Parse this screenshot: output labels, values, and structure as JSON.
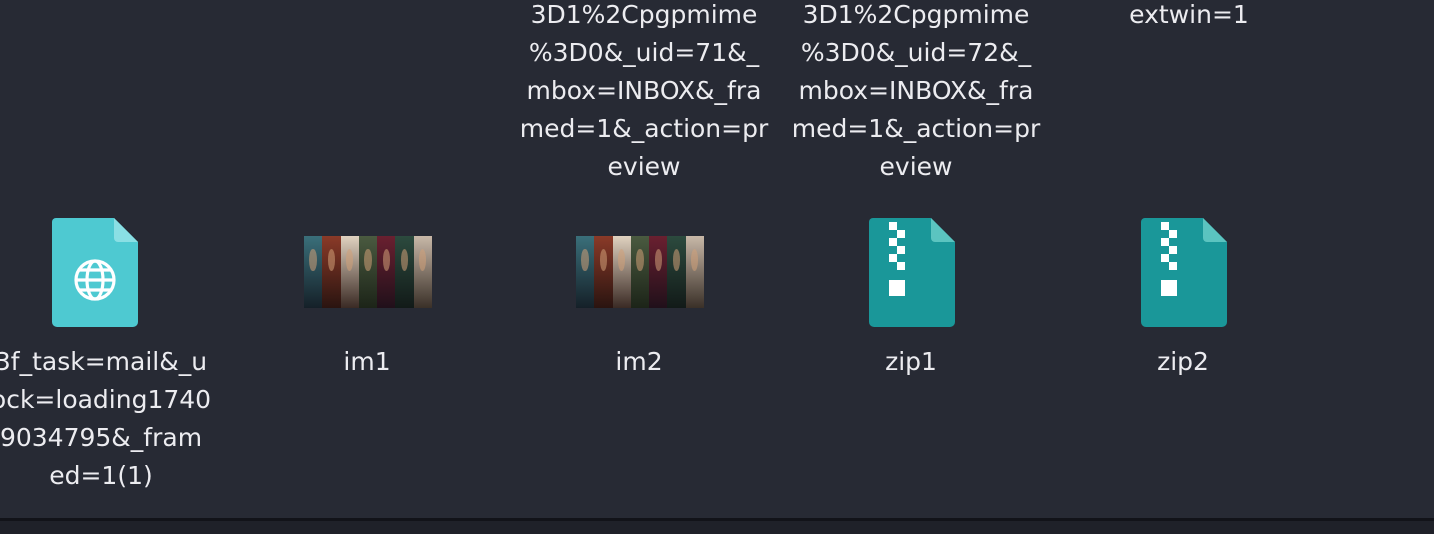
{
  "files": {
    "html_file": {
      "name": "3f_task=mail&_u\nock=loading1740\n9034795&_fram\ned=1(1)",
      "icon": "web-document-icon",
      "color": "#4ec9d1"
    },
    "im1": {
      "name": "im1",
      "icon": "image-thumbnail"
    },
    "im2": {
      "name": "im2",
      "icon": "image-thumbnail"
    },
    "zip1": {
      "name": "zip1",
      "icon": "zip-archive-icon",
      "color": "#1a9799"
    },
    "zip2": {
      "name": "zip2",
      "icon": "zip-archive-icon",
      "color": "#1a9799"
    },
    "top_row": {
      "col2_name": "3D1%2Cpgpmime\n%3D0&_uid=71&_\nmbox=INBOX&_fra\nmed=1&_action=pr\neview",
      "col3_name": "3D1%2Cpgpmime\n%3D0&_uid=72&_\nmbox=INBOX&_fra\nmed=1&_action=pr\neview",
      "col4_name": "extwin=1"
    }
  },
  "colors": {
    "background": "#272a34",
    "text": "#ececf0",
    "web_icon": "#4ec9d1",
    "zip_icon": "#1a9799"
  }
}
